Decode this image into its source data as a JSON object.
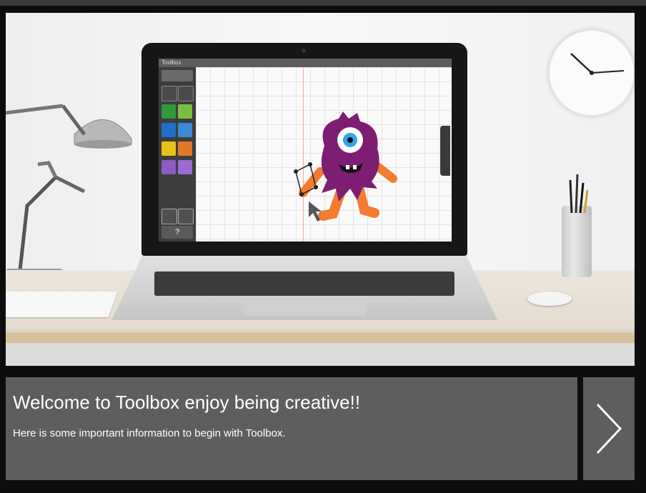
{
  "app": {
    "window_title": "Toolbox"
  },
  "welcome": {
    "title": "Welcome to Toolbox enjoy being creative!!",
    "subtitle": "Here is some important information to begin with Toolbox."
  },
  "toolbar_icons": [
    "back-arrow-icon",
    "undo-icon",
    "redo-icon",
    "eye-icon",
    "page-icon",
    "stamp-icon",
    "fill-icon",
    "text-icon",
    "shapes-icon",
    "copy-icon",
    "image-icon",
    "print-icon",
    "save-icon",
    "help-icon"
  ],
  "toolbar_help_label": "?",
  "colors": {
    "panel": "#5e5e5e",
    "background": "#0d0d0d",
    "monster_body": "#7d1e72",
    "monster_limbs": "#f47b30"
  },
  "next_icon": "chevron-right-icon"
}
